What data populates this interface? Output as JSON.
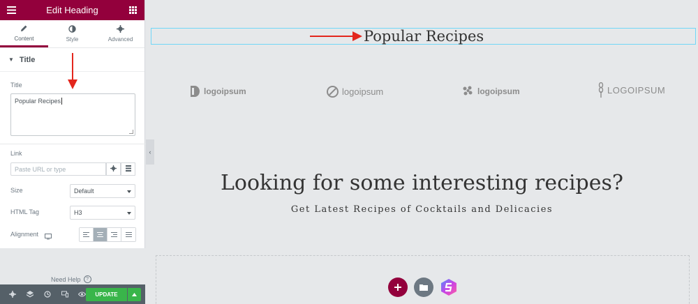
{
  "panel": {
    "title": "Edit Heading",
    "tabs": [
      {
        "label": "Content",
        "icon": "pencil-icon"
      },
      {
        "label": "Style",
        "icon": "contrast-icon"
      },
      {
        "label": "Advanced",
        "icon": "gear-icon"
      }
    ],
    "section_title": "Title",
    "title_label": "Title",
    "title_value": "Popular Recipes",
    "link_label": "Link",
    "link_placeholder": "Paste URL or type",
    "size_label": "Size",
    "size_value": "Default",
    "html_tag_label": "HTML Tag",
    "html_tag_value": "H3",
    "alignment_label": "Alignment",
    "alignment_selected": "center",
    "need_help": "Need Help",
    "update_label": "UPDATE"
  },
  "canvas": {
    "heading": "Popular Recipes",
    "logos": [
      "logoipsum",
      "logoipsum",
      "logoipsum",
      "LOGOIPSUM"
    ],
    "main_title": "Looking for some interesting recipes?",
    "subtitle": "Get Latest Recipes of Cocktails and Delicacies"
  },
  "colors": {
    "brand": "#93003c",
    "update": "#39b54a",
    "annotation_arrow": "#e3261d",
    "selection_outline": "#71d7f7"
  }
}
